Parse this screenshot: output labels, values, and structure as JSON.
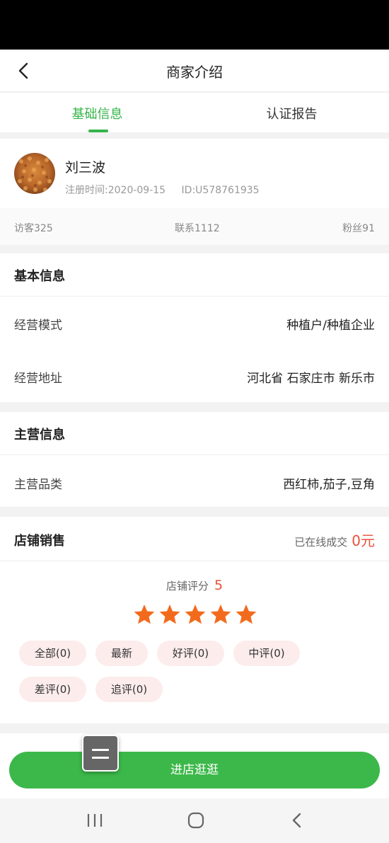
{
  "header": {
    "title": "商家介绍"
  },
  "tabs": [
    {
      "label": "基础信息",
      "active": true
    },
    {
      "label": "认证报告",
      "active": false
    }
  ],
  "merchant": {
    "name": "刘三波",
    "register_time": "注册时间:2020-09-15",
    "id": "ID:U578761935"
  },
  "stats": {
    "visitors": "访客325",
    "contacts": "联系1112",
    "fans": "粉丝91"
  },
  "basic_info": {
    "title": "基本信息",
    "rows": [
      {
        "label": "经营模式",
        "value": "种植户/种植企业"
      },
      {
        "label": "经营地址",
        "value": "河北省 石家庄市 新乐市"
      }
    ]
  },
  "main_business": {
    "title": "主营信息",
    "rows": [
      {
        "label": "主营品类",
        "value": "西红柿,茄子,豆角"
      }
    ]
  },
  "sales": {
    "title": "店铺销售",
    "done_label": "已在线成交",
    "done_amount": "0元",
    "score_label": "店铺评分",
    "score_value": "5",
    "stars": 5,
    "filters": [
      "全部(0)",
      "最新",
      "好评(0)",
      "中评(0)",
      "差评(0)",
      "追评(0)"
    ]
  },
  "cta": {
    "label": "进店逛逛"
  },
  "colors": {
    "accent": "#36b54a",
    "price": "#e8513b",
    "star": "#f26b1d",
    "chip_bg": "#fdecec"
  },
  "icons": {
    "back": "chevron-left-icon",
    "menu": "menu-icon",
    "recents": "recent-apps-icon",
    "home": "home-icon",
    "sys_back": "system-back-icon"
  }
}
